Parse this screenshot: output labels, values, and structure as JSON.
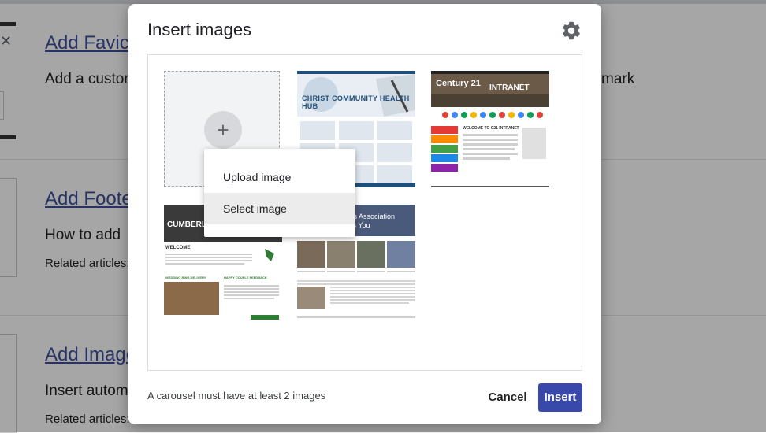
{
  "background": {
    "sections": [
      {
        "title": "Add Favic",
        "description": "Add a custon",
        "trailing": "mark"
      },
      {
        "title": "Add Foote",
        "description": "How to add",
        "related": "Related articles:"
      },
      {
        "title": "Add Image",
        "description": "Insert autom",
        "related": "Related articles:"
      }
    ],
    "close_glyph": "✕"
  },
  "dialog": {
    "title": "Insert images",
    "settings_icon": "gear-icon",
    "add_tile_glyph": "+",
    "menu": {
      "items": [
        "Upload image",
        "Select image"
      ],
      "highlighted_index": 1
    },
    "thumbnails": [
      {
        "name": "christ-community-health",
        "logo_text": "CHRIST COMMUNITY HEALTH HUB"
      },
      {
        "name": "century21-intranet",
        "brand": "Century 21",
        "heading": "INTRANET",
        "welcome": "WELCOME TO C21 INTRANET"
      },
      {
        "name": "cumberland",
        "brand": "CUMBERLAND",
        "welcome": "WELCOME",
        "captions": [
          "WEDDING RING DELIVERY",
          "HAPPY COUPLE FEEDBACK"
        ]
      },
      {
        "name": "studies-association",
        "banner": [
          "Studies Association",
          "mes You"
        ]
      }
    ],
    "footer_note": "A carousel must have at least 2 images",
    "cancel_label": "Cancel",
    "insert_label": "Insert",
    "colors": {
      "accent": "#3949ab",
      "menu_highlight": "#ececec"
    }
  }
}
